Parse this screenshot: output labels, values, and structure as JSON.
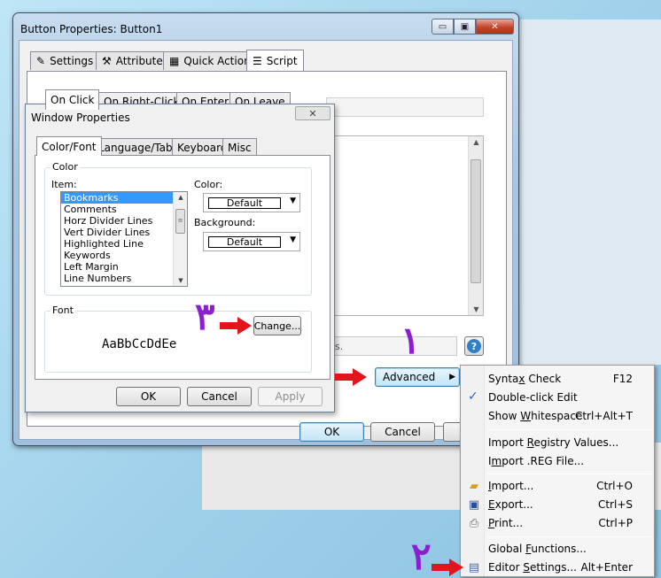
{
  "main_window": {
    "title": "Button Properties: Button1",
    "caption_buttons": {
      "minimize": "▭",
      "maximize": "▣",
      "close": "✕"
    },
    "tabs": [
      {
        "label": "Settings",
        "icon": "pencil-icon"
      },
      {
        "label": "Attributes",
        "icon": "wand-icon"
      },
      {
        "label": "Quick Action",
        "icon": "grid-icon"
      },
      {
        "label": "Script",
        "icon": "script-icon",
        "active": true
      }
    ],
    "subtabs": [
      {
        "label": "On Click",
        "active": true
      },
      {
        "label": "On Right-Click"
      },
      {
        "label": "On Enter"
      },
      {
        "label": "On Leave"
      }
    ],
    "status_text": "ns.",
    "buttons": {
      "advanced": "Advanced",
      "ok": "OK",
      "cancel": "Cancel"
    }
  },
  "window_properties": {
    "title": "Window Properties",
    "close_glyph": "✕",
    "tabs": [
      "Color/Font",
      "Language/Tabs",
      "Keyboard",
      "Misc"
    ],
    "active_tab": "Color/Font",
    "color_group": {
      "label": "Color",
      "item_label": "Item:",
      "items": [
        "Bookmarks",
        "Comments",
        "Horz Divider Lines",
        "Vert Divider Lines",
        "Highlighted Line",
        "Keywords",
        "Left Margin",
        "Line Numbers"
      ],
      "selected_item": "Bookmarks",
      "color_label": "Color:",
      "color_value": "Default",
      "background_label": "Background:",
      "background_value": "Default"
    },
    "font_group": {
      "label": "Font",
      "change_button": "Change...",
      "sample": "AaBbCcDdEe"
    },
    "buttons": {
      "ok": "OK",
      "cancel": "Cancel",
      "apply": "Apply"
    }
  },
  "context_menu": {
    "items": [
      {
        "label": "Syntax Check",
        "mnemonic_index": 5,
        "shortcut": "F12"
      },
      {
        "label": "Double-click Edit",
        "checked": true,
        "shortcut": ""
      },
      {
        "label": "Show Whitespace",
        "mnemonic_index": 5,
        "shortcut": "Ctrl+Alt+T"
      },
      {
        "label": "Import Registry Values...",
        "mnemonic_index": 7,
        "shortcut": ""
      },
      {
        "label": "Import .REG File...",
        "mnemonic_index": 1,
        "shortcut": ""
      },
      {
        "label": "Import...",
        "icon": "folder-icon",
        "mnemonic_index": 0,
        "shortcut": "Ctrl+O"
      },
      {
        "label": "Export...",
        "icon": "save-icon",
        "mnemonic_index": 0,
        "shortcut": "Ctrl+S"
      },
      {
        "label": "Print...",
        "icon": "printer-icon",
        "mnemonic_index": 0,
        "shortcut": "Ctrl+P"
      },
      {
        "label": "Global Functions...",
        "mnemonic_index": 7,
        "shortcut": ""
      },
      {
        "label": "Editor Settings...",
        "icon": "editor-settings-icon",
        "mnemonic_index": 7,
        "shortcut": "Alt+Enter"
      }
    ]
  },
  "annotations": {
    "step_1": "١",
    "step_2": "٢",
    "step_3": "٣",
    "arrow_color": "#e3141b",
    "number_color": "#8b1fd0"
  }
}
